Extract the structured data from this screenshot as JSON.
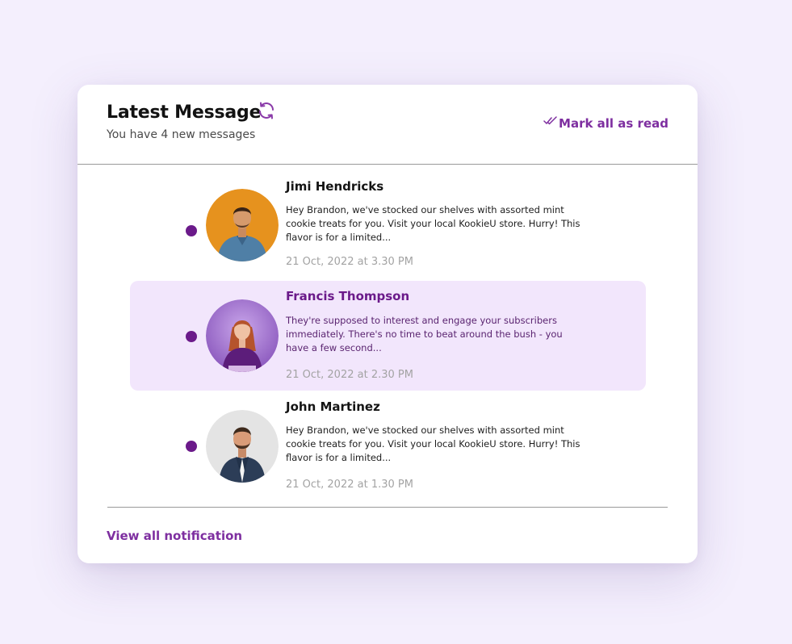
{
  "header": {
    "title": "Latest Message",
    "subtitle": "You have 4 new messages",
    "refresh_icon": "refresh-icon",
    "mark_all_label": "Mark all as read",
    "mark_all_icon": "double-check-icon"
  },
  "messages": [
    {
      "name": "Jimi Hendricks",
      "body": "Hey Brandon, we've stocked our shelves with assorted mint cookie treats for you. Visit your local KookieU store. Hurry! This flavor is for a limited...",
      "time": "21 Oct, 2022 at 3.30 PM",
      "unread": true,
      "highlighted": false,
      "avatar_bg": "#e6921e"
    },
    {
      "name": "Francis Thompson",
      "body": "They're supposed to interest and engage your subscribers immediately. There's no time to beat around the bush - you have a few second...",
      "time": "21 Oct, 2022 at 2.30 PM",
      "unread": true,
      "highlighted": true,
      "avatar_bg": "#9b6cc8"
    },
    {
      "name": "John Martinez",
      "body": "Hey Brandon, we've stocked our shelves with assorted mint cookie treats for you. Visit your local KookieU store. Hurry! This flavor is for a limited...",
      "time": "21 Oct, 2022 at 1.30 PM",
      "unread": true,
      "highlighted": false,
      "avatar_bg": "#e4e4e4"
    }
  ],
  "footer": {
    "view_all_label": "View all notification"
  },
  "colors": {
    "accent": "#7e2fa0",
    "unread_dot": "#6b1a8a",
    "highlight_bg": "#f2e6fc",
    "page_bg": "#f4effd"
  }
}
